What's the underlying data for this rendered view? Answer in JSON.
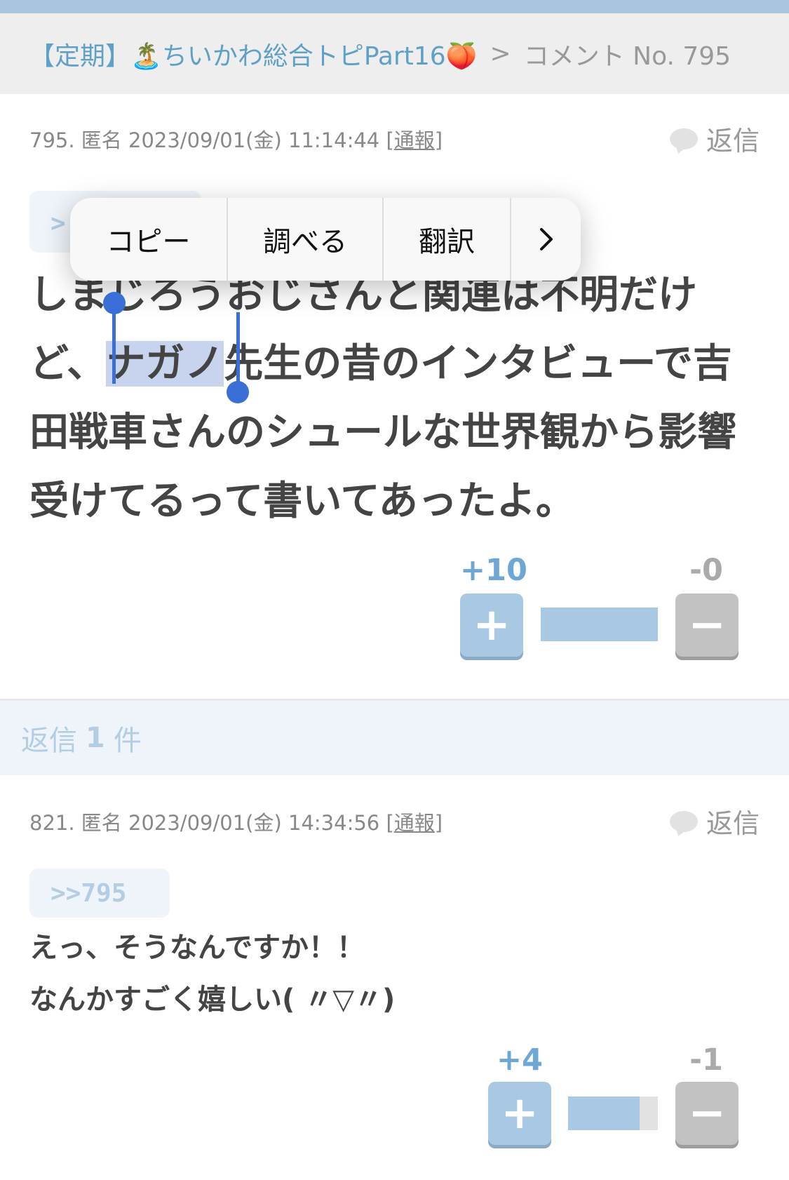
{
  "breadcrumb": {
    "topic_title": "【定期】🏝️ちいかわ総合トピPart16🍑",
    "separator": ">",
    "current": "コメント No. 795"
  },
  "comments": [
    {
      "meta_prefix": "795. 匿名 2023/09/01(金) 11:14:44 [",
      "report": "通報",
      "meta_suffix": "]",
      "reply_label": "返信",
      "anchor": ">",
      "body_hidden": "しまじろうおじさんと関連は不明だけ",
      "body_before": "ど、",
      "body_selected": "ナガノ",
      "body_after": "先生の昔のインタビューで吉田戦車さんのシュールな世界観から影響受けてるって書いてあったよ。",
      "plus": "+10",
      "minus": "-0",
      "plus_ratio": 1.0
    },
    {
      "meta_prefix": "821. 匿名 2023/09/01(金) 14:34:56 [",
      "report": "通報",
      "meta_suffix": "]",
      "reply_label": "返信",
      "anchor": ">>795",
      "body_line1": "えっ、そうなんですか！！",
      "body_line2": "なんかすごく嬉しい( 〃▽〃)",
      "plus": "+4",
      "minus": "-1",
      "plus_ratio": 0.8
    }
  ],
  "replies": {
    "prefix": "返信",
    "count": "1",
    "suffix": "件"
  },
  "context_menu": {
    "items": [
      "コピー",
      "調べる",
      "翻訳"
    ],
    "more_icon": "chevron-right-icon"
  },
  "colors": {
    "accent": "#a8c8e3",
    "link": "#5fa0c6",
    "selection": "#c8d4ee",
    "handle": "#3a6fd8"
  }
}
